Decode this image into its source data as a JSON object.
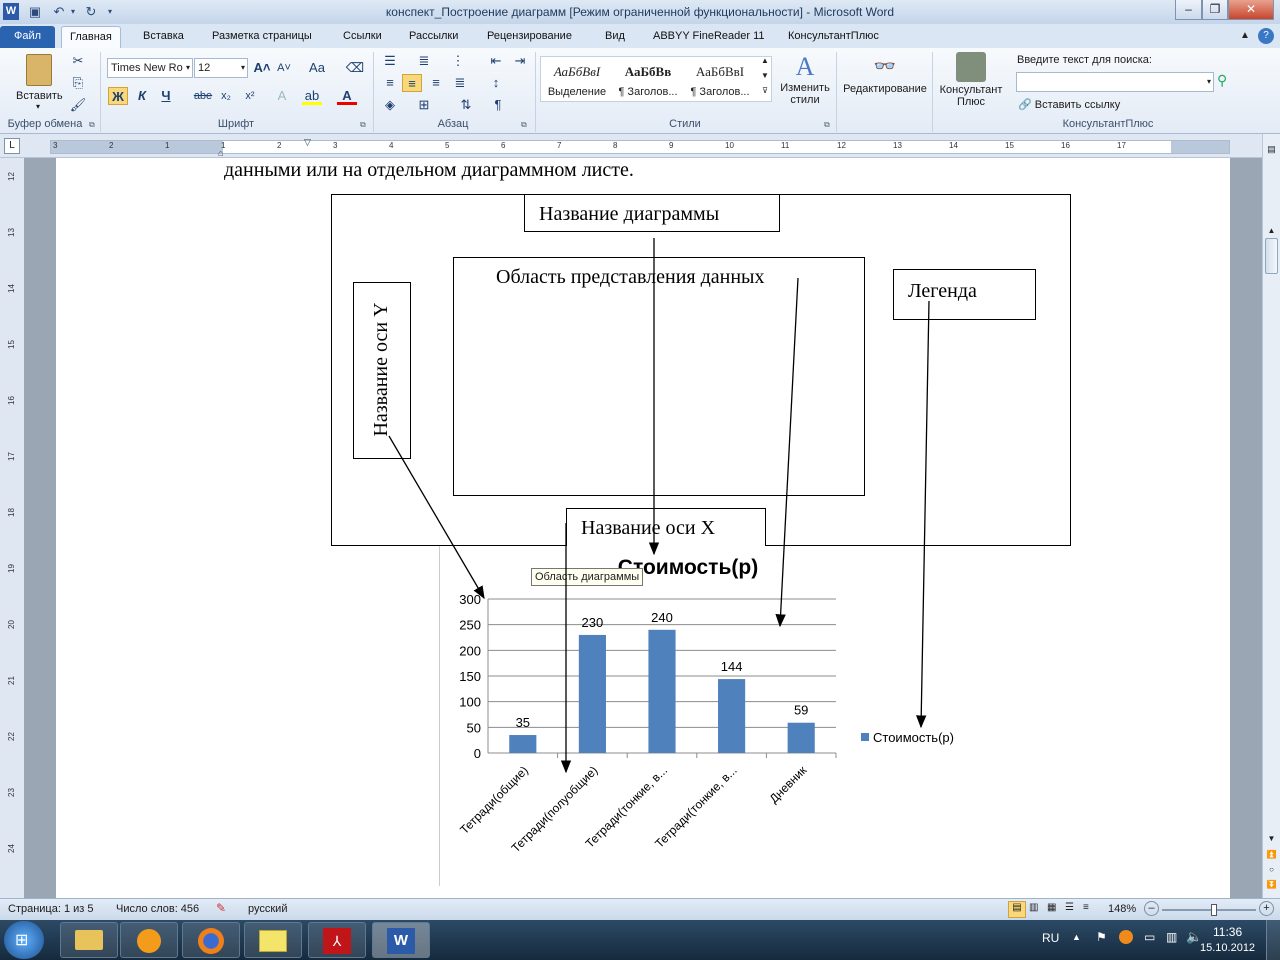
{
  "window": {
    "title": "конспект_Построение диаграмм [Режим ограниченной функциональности]  -  Microsoft Word"
  },
  "tabs": [
    "Файл",
    "Главная",
    "Вставка",
    "Разметка страницы",
    "Ссылки",
    "Рассылки",
    "Рецензирование",
    "Вид",
    "ABBYY FineReader 11",
    "КонсультантПлюс"
  ],
  "ribbon": {
    "clipboard": {
      "paste": "Вставить",
      "label": "Буфер обмена"
    },
    "font": {
      "name": "Times New Ro",
      "size": "12",
      "bold": "Ж",
      "italic": "К",
      "underline": "Ч",
      "strike": "abe",
      "sub": "x₂",
      "sup": "x²",
      "label": "Шрифт",
      "aa": "Аа"
    },
    "paragraph": {
      "label": "Абзац"
    },
    "styles": {
      "label": "Стили",
      "items": [
        {
          "preview": "АаБбВвІ",
          "name": "Выделение"
        },
        {
          "preview": "АаБбВв",
          "name": "¶ Заголов..."
        },
        {
          "preview": "АаБбВвІ",
          "name": "¶ Заголов..."
        }
      ],
      "change": "Изменить стили"
    },
    "editing": {
      "label": "Редактирование"
    },
    "consultant": {
      "button": "Консультант Плюс",
      "search_label": "Введите текст для поиска:",
      "insert_link": "Вставить ссылку",
      "label": "КонсультантПлюс"
    }
  },
  "ruler": {
    "h_ticks": [
      "3",
      "2",
      "1",
      "1",
      "2",
      "3",
      "4",
      "5",
      "6",
      "7",
      "8",
      "9",
      "10",
      "11",
      "12",
      "13",
      "14",
      "15",
      "16",
      "17"
    ],
    "v_ticks": [
      "12",
      "13",
      "14",
      "15",
      "16",
      "17",
      "18",
      "19",
      "20",
      "21",
      "22",
      "23",
      "24"
    ]
  },
  "document": {
    "top_text": "данными или на отдельном диаграммном листе.",
    "diagram": {
      "title_box": "Название диаграммы",
      "plot_area_box": "Область представления данных",
      "legend_box": "Легенда",
      "y_axis_box": "Название оси Y",
      "x_axis_box": "Название оси X"
    },
    "tooltip": "Область диаграммы"
  },
  "chart_data": {
    "type": "bar",
    "title": "Стоимость(р)",
    "categories": [
      "Тетради(общие)",
      "Тетради(полуобщие)",
      "Тетради(тонкие, в...",
      "Тетради(тонкие, в...",
      "Дневник"
    ],
    "series": [
      {
        "name": "Стоимость(р)",
        "values": [
          35,
          230,
          240,
          144,
          59
        ],
        "color": "#4f81bd"
      }
    ],
    "ylim": [
      0,
      300
    ],
    "yticks": [
      0,
      50,
      100,
      150,
      200,
      250,
      300
    ],
    "grid": true,
    "legend": "right",
    "data_labels": true
  },
  "status": {
    "page": "Страница: 1 из 5",
    "words": "Число слов: 456",
    "lang": "русский",
    "zoom": "148%"
  },
  "taskbar": {
    "lang": "RU",
    "time": "11:36",
    "date": "15.10.2012"
  }
}
